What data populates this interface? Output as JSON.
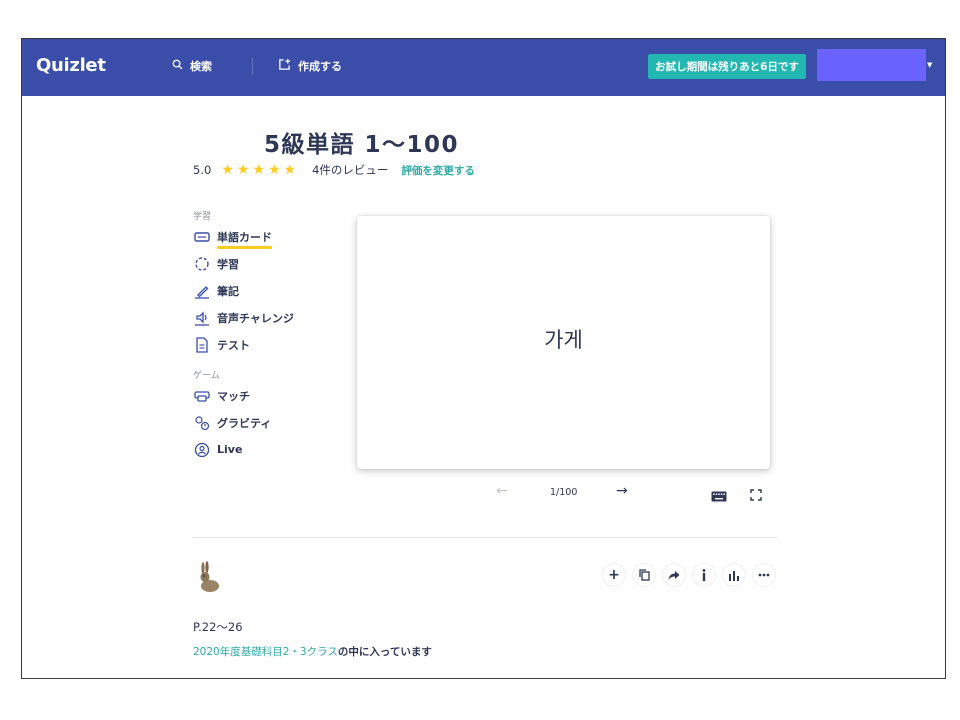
{
  "header": {
    "logo": "Quizlet",
    "search_label": "検索",
    "create_label": "作成する",
    "trial_button": "お試し期間は残りあと6日です",
    "accent_color": "#3a4da9",
    "trial_color": "#23b7b2",
    "user_box_color": "#6b63ff"
  },
  "set": {
    "title": "5級単語 1〜100",
    "rating": "5.0",
    "stars": 5,
    "review_count": "4件のレビュー",
    "rate_link": "評価を変更する"
  },
  "sidebar": {
    "study_heading": "学習",
    "study_items": [
      {
        "label": "単語カード",
        "icon": "flashcards-icon",
        "active": true
      },
      {
        "label": "学習",
        "icon": "learn-icon"
      },
      {
        "label": "筆記",
        "icon": "write-icon"
      },
      {
        "label": "音声チャレンジ",
        "icon": "spell-icon"
      },
      {
        "label": "テスト",
        "icon": "test-icon"
      }
    ],
    "games_heading": "ゲーム",
    "game_items": [
      {
        "label": "マッチ",
        "icon": "match-icon"
      },
      {
        "label": "グラビティ",
        "icon": "gravity-icon"
      },
      {
        "label": "Live",
        "icon": "live-icon"
      }
    ]
  },
  "card": {
    "term": "가게",
    "counter": "1/100"
  },
  "footer": {
    "description": "P.22〜26",
    "class_link": "2020年度基礎科目2・3クラス",
    "class_suffix": "の中に入っています"
  },
  "actions": [
    "add-icon",
    "copy-icon",
    "share-icon",
    "info-icon",
    "stats-icon",
    "more-icon"
  ]
}
